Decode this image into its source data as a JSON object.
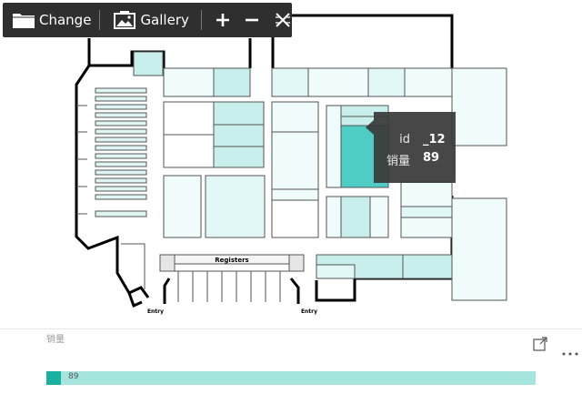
{
  "toolbar": {
    "change_label": "Change",
    "gallery_label": "Gallery",
    "icons": [
      "folder-icon",
      "gallery-icon",
      "zoom-in-icon",
      "zoom-out-icon",
      "reset-view-icon"
    ]
  },
  "floorplan": {
    "registers_label": "Registers",
    "entry_left_label": "Entry",
    "entry_right_label": "Entry"
  },
  "tooltip": {
    "id_key": "id",
    "id_value": "_12",
    "sales_key": "销量",
    "sales_value": "89"
  },
  "legend": {
    "title": "销量",
    "value_label": "89",
    "value": 89,
    "max": 89
  },
  "colors": {
    "toolbar_bg": "#2f2f2f",
    "highlight_fill": "#4ecdc4",
    "shelf_fill": "#c8efec",
    "shelf_light": "#effcfb",
    "legend_bar": "#a6e4de",
    "legend_swatch": "#19b2a0"
  }
}
